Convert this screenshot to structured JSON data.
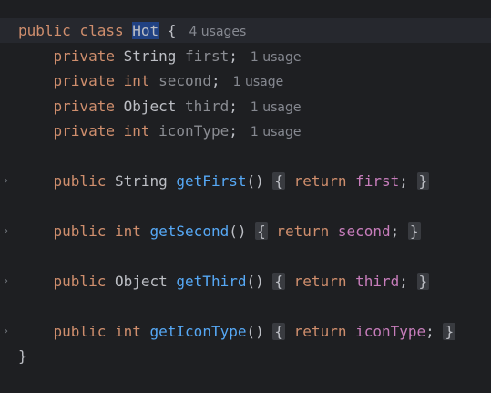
{
  "editor": {
    "class_decl": {
      "kw_public": "public",
      "kw_class": "class",
      "name": "Hot",
      "brace_open": "{",
      "usages": "4 usages"
    },
    "fields": [
      {
        "kw": "private",
        "type": "String",
        "name": "first",
        "semi": ";",
        "usages": "1 usage"
      },
      {
        "kw": "private",
        "type": "int",
        "name": "second",
        "semi": ";",
        "usages": "1 usage"
      },
      {
        "kw": "private",
        "type": "Object",
        "name": "third",
        "semi": ";",
        "usages": "1 usage"
      },
      {
        "kw": "private",
        "type": "int",
        "name": "iconType",
        "semi": ";",
        "usages": "1 usage"
      }
    ],
    "methods": [
      {
        "kw": "public",
        "type": "String",
        "name": "getFirst",
        "parens": "()",
        "ret_kw": "return",
        "ret_val": "first",
        "semi": ";"
      },
      {
        "kw": "public",
        "type": "int",
        "name": "getSecond",
        "parens": "()",
        "ret_kw": "return",
        "ret_val": "second",
        "semi": ";"
      },
      {
        "kw": "public",
        "type": "Object",
        "name": "getThird",
        "parens": "()",
        "ret_kw": "return",
        "ret_val": "third",
        "semi": ";"
      },
      {
        "kw": "public",
        "type": "int",
        "name": "getIconType",
        "parens": "()",
        "ret_kw": "return",
        "ret_val": "iconType",
        "semi": ";"
      }
    ],
    "brace_open": "{",
    "brace_close": "}",
    "fold_marker": "›"
  }
}
